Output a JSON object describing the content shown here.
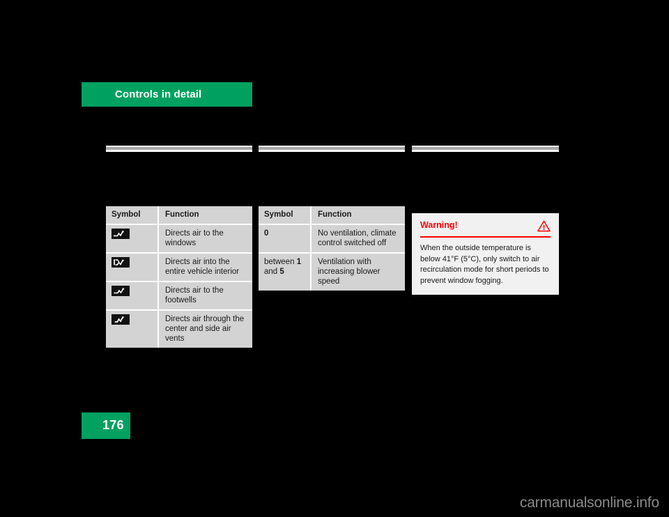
{
  "page": {
    "chapter_title": "Controls in detail",
    "page_number": "176",
    "watermark": "carmanualsonline.info",
    "background_color": "#000000",
    "accent_green": "#00A160",
    "warning_red": "#ff0000",
    "table_bg": "#d3d3d3"
  },
  "rules": [
    {
      "name": "rule-column-1"
    },
    {
      "name": "rule-column-2"
    },
    {
      "name": "rule-column-3"
    }
  ],
  "air_distribution_table": {
    "headers": {
      "symbol": "Symbol",
      "function": "Function"
    },
    "rows": [
      {
        "icon": "air-to-windows-icon",
        "symbol": "",
        "function": "Directs air to the windows"
      },
      {
        "icon": "air-to-entire-interior-icon",
        "symbol": "",
        "function": "Directs air into the entire vehicle interior"
      },
      {
        "icon": "air-to-footwells-icon",
        "symbol": "",
        "function": "Directs air to the footwells"
      },
      {
        "icon": "air-to-center-side-vents-icon",
        "symbol": "",
        "function": "Directs air through the center and side air vents"
      }
    ]
  },
  "blower_table": {
    "headers": {
      "symbol": "Symbol",
      "function": "Function"
    },
    "rows": [
      {
        "symbol_plain": "0",
        "symbol_prefix": "",
        "symbol_bold_1": "",
        "symbol_mid": "",
        "symbol_bold_2": "",
        "function": "No ventilation, climate control switched off"
      },
      {
        "symbol_plain": "",
        "symbol_prefix": "between ",
        "symbol_bold_1": "1",
        "symbol_mid": "and ",
        "symbol_bold_2": "5",
        "function": "Ventilation with increasing blower speed"
      }
    ]
  },
  "warning": {
    "title": "Warning!",
    "icon": "warning-triangle-icon",
    "text": "When the outside temperature is below 41°F (5°C), only switch to air recirculation mode for short periods to prevent window fogging."
  }
}
